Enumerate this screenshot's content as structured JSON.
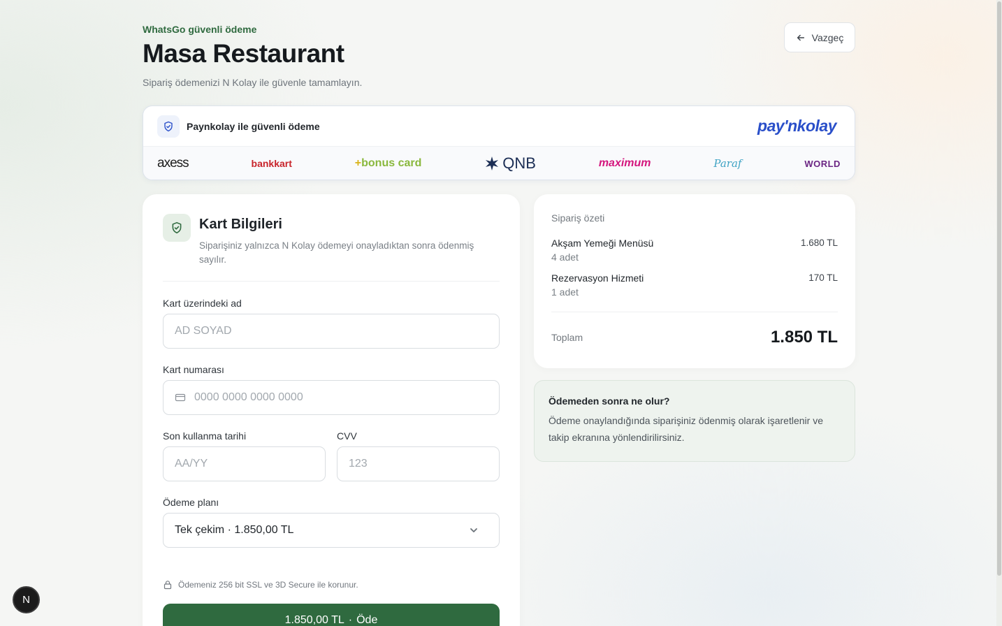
{
  "header": {
    "eyebrow": "WhatsGo güvenli ödeme",
    "title": "Masa Restaurant",
    "subtitle": "Sipariş ödemenizi N Kolay ile güvenle tamamlayın.",
    "cancel_label": "Vazgeç"
  },
  "provider": {
    "text": "Paynkolay ile güvenli ödeme",
    "logo": "pay'nkolay",
    "banks": [
      "axess",
      "bankkart",
      "bonus card",
      "QNB",
      "maximum",
      "Paraf",
      "WORLD"
    ]
  },
  "card_form": {
    "title": "Kart Bilgileri",
    "description": "Siparişiniz yalnızca N Kolay ödemeyi onayladıktan sonra ödenmiş sayılır.",
    "name_label": "Kart üzerindeki ad",
    "name_placeholder": "AD SOYAD",
    "number_label": "Kart numarası",
    "number_placeholder": "0000 0000 0000 0000",
    "expiry_label": "Son kullanma tarihi",
    "expiry_placeholder": "AA/YY",
    "cvv_label": "CVV",
    "cvv_placeholder": "123",
    "plan_label": "Ödeme planı",
    "plan_value": "Tek çekim · 1.850,00 TL",
    "secure_note": "Ödemeniz 256 bit SSL ve 3D Secure ile korunur.",
    "pay_amount": "1.850,00 TL",
    "pay_separator": "·",
    "pay_label": "Öde"
  },
  "summary": {
    "title": "Sipariş özeti",
    "items": [
      {
        "name": "Akşam Yemeği Menüsü",
        "qty": "4 adet",
        "price": "1.680 TL"
      },
      {
        "name": "Rezervasyon Hizmeti",
        "qty": "1 adet",
        "price": "170 TL"
      }
    ],
    "total_label": "Toplam",
    "total_value": "1.850 TL"
  },
  "info": {
    "title": "Ödemeden sonra ne olur?",
    "text": "Ödeme onaylandığında siparişiniz ödenmiş olarak işaretlenir ve takip ekranına yönlendirilirsiniz."
  },
  "badge": {
    "letter": "N"
  },
  "colors": {
    "brand_green": "#2f6a3f",
    "paynkolay_blue": "#2a4fc9"
  }
}
